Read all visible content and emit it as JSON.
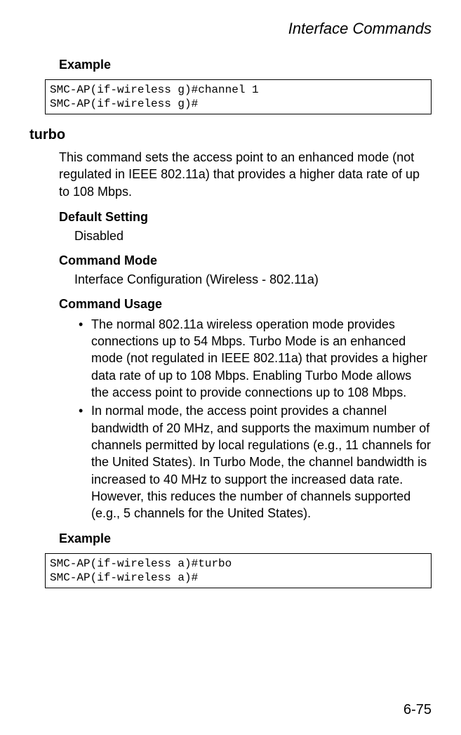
{
  "header": "Interface Commands",
  "section1": {
    "heading": "Example",
    "code": "SMC-AP(if-wireless g)#channel 1\nSMC-AP(if-wireless g)#"
  },
  "command": {
    "name": "turbo",
    "description": "This command sets the access point to an enhanced mode (not regulated in IEEE 802.11a) that provides a higher data rate of up to 108 Mbps.",
    "default_setting": {
      "heading": "Default Setting",
      "value": "Disabled"
    },
    "command_mode": {
      "heading": "Command Mode",
      "value": "Interface Configuration (Wireless - 802.11a)"
    },
    "command_usage": {
      "heading": "Command Usage",
      "items": [
        "The normal 802.11a wireless operation mode provides connections up to 54 Mbps. Turbo Mode is an enhanced mode (not regulated in IEEE 802.11a) that provides a higher data rate of up to 108 Mbps. Enabling Turbo Mode allows the access point to provide connections up to 108 Mbps.",
        "In normal mode, the access point provides a channel bandwidth of 20 MHz, and supports the maximum number of channels permitted by local regulations (e.g., 11 channels for the United States). In Turbo Mode, the channel bandwidth is increased to 40 MHz to support the increased data rate. However, this reduces the number of channels supported (e.g., 5 channels for the United States)."
      ]
    },
    "example": {
      "heading": "Example",
      "code": "SMC-AP(if-wireless a)#turbo\nSMC-AP(if-wireless a)#"
    }
  },
  "page_number": "6-75"
}
